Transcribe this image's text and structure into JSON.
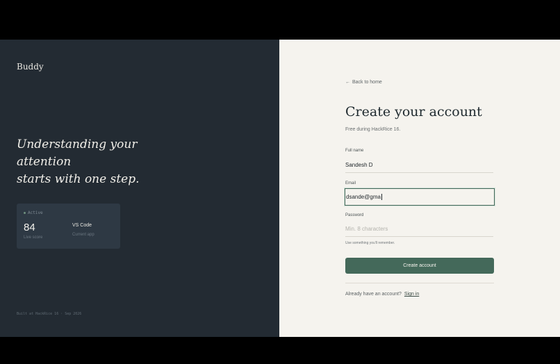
{
  "brand": {
    "name": "Buddy"
  },
  "hero": {
    "tagline_lines": [
      "Understanding your",
      "attention",
      "starts with one step."
    ]
  },
  "status_card": {
    "status": "Active",
    "score": "84",
    "score_label": "Live score",
    "app": "VS Code",
    "app_label": "Current app"
  },
  "footer_note": "Built at HackRice 16 · Sep 2026",
  "form": {
    "back_link": "Back to home",
    "title": "Create your account",
    "subtitle": "Free during HackRice 16.",
    "full_name": {
      "label": "Full name",
      "value": "Sandesh D"
    },
    "email": {
      "label": "Email",
      "value": "dsande@gma"
    },
    "password": {
      "label": "Password",
      "placeholder": "Min. 8 characters",
      "hint": "Use something you'll remember."
    },
    "submit_label": "Create account",
    "signin_prompt": "Already have an account?",
    "signin_link": "Sign in"
  },
  "colors": {
    "left_panel_bg": "#232b33",
    "right_panel_bg": "#f5f3ee",
    "accent": "#44695a"
  }
}
